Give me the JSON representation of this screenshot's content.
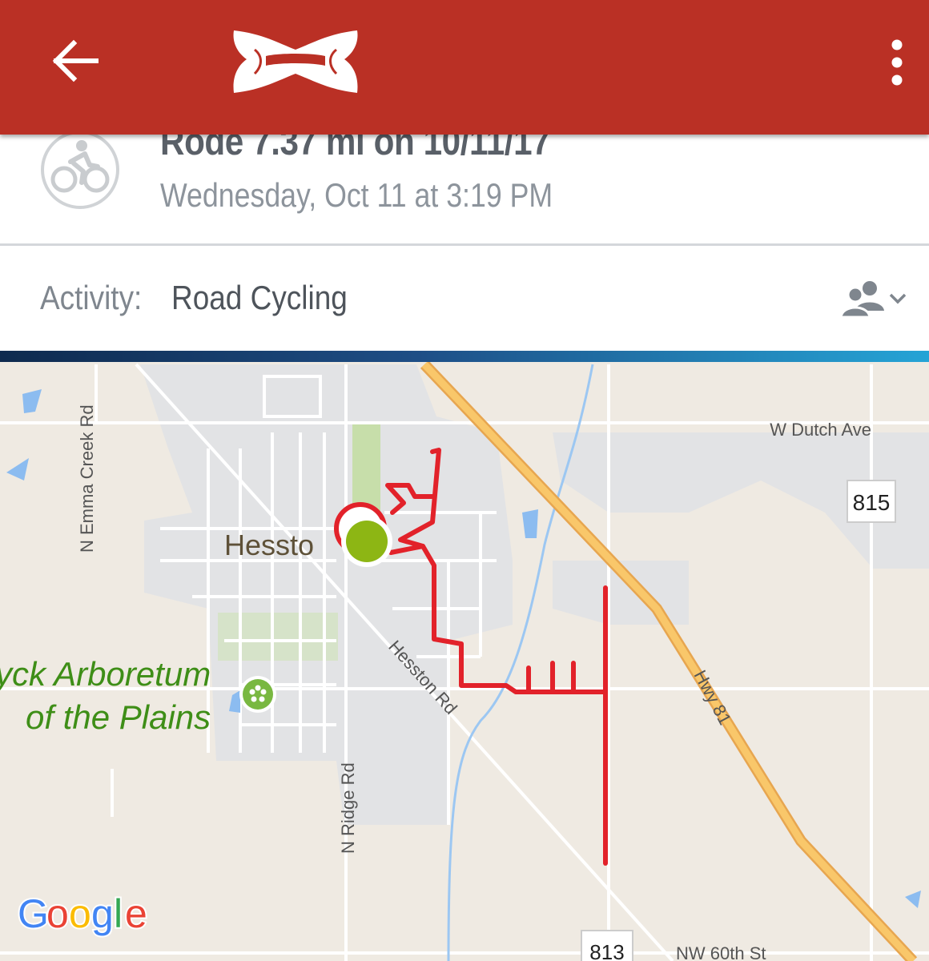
{
  "appbar": {
    "back_icon": "arrow-left-icon",
    "logo": "under-armour-logo",
    "menu_icon": "more-vert-icon",
    "color": "#BA3025"
  },
  "workout": {
    "title": "Rode 7.37 mi on 10/11/17",
    "subtitle": "Wednesday, Oct 11 at 3:19 PM",
    "avatar_icon": "cyclist-icon"
  },
  "activity": {
    "label": "Activity:",
    "value": "Road Cycling",
    "privacy_icon": "friends-icon"
  },
  "map": {
    "labels": {
      "dutch_ave": "W Dutch Ave",
      "emma_creek": "N Emma Creek Rd",
      "town": "Hessto",
      "arboretum_1": "yck Arboretum",
      "arboretum_2": "of the Plains",
      "hesston_rd": "Hesston Rd",
      "hwy81": "Hwy 81",
      "ridge_rd": "N Ridge Rd",
      "route_815": "815",
      "route_813": "813",
      "nw60": "NW 60th St",
      "google": "Google"
    },
    "route_color": "#E2222A",
    "start_color": "#8DB614"
  }
}
